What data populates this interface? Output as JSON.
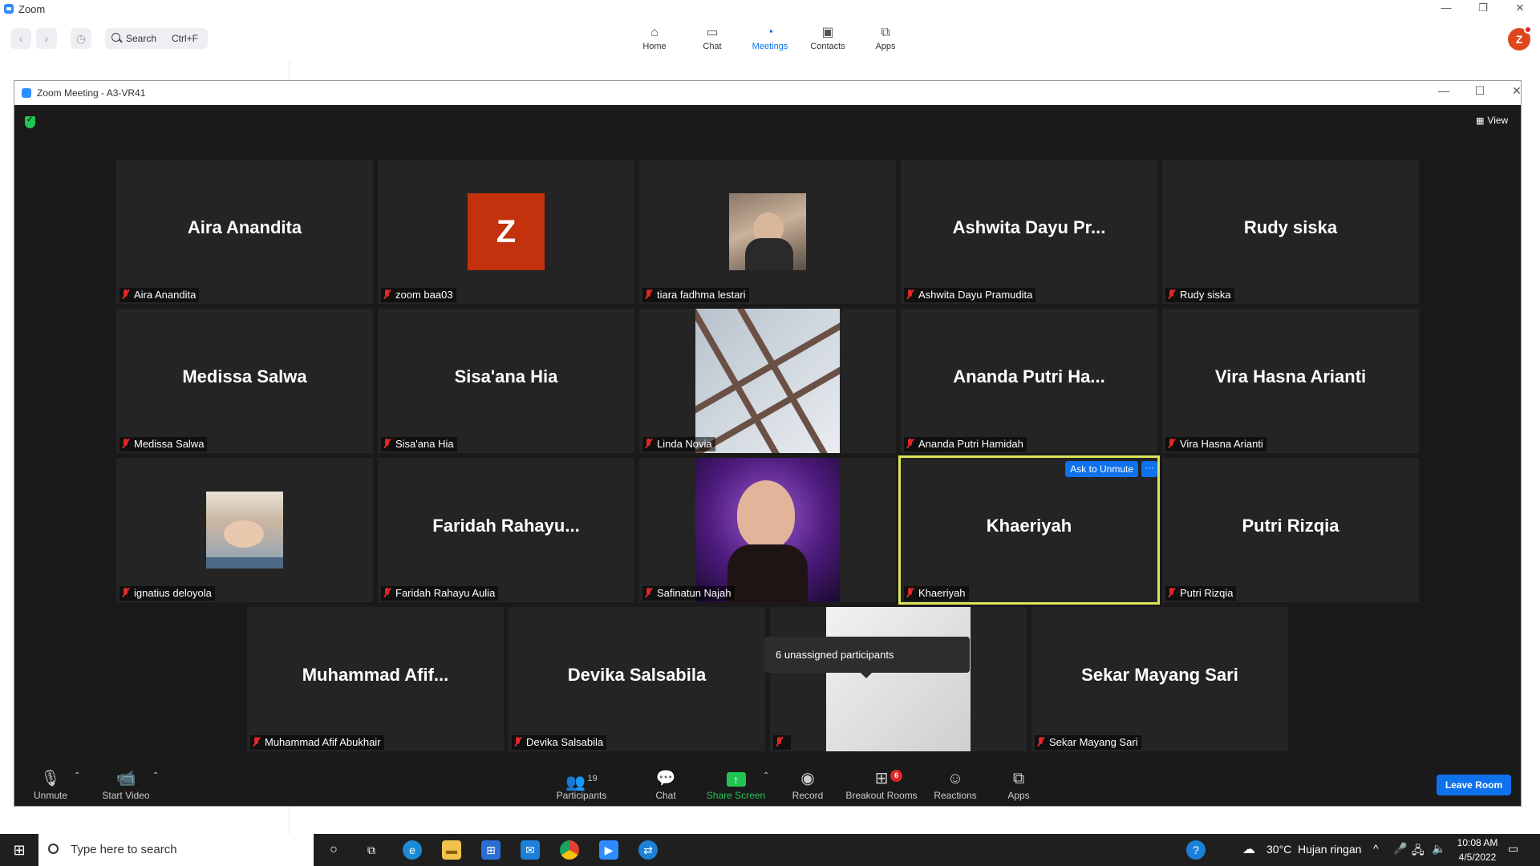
{
  "app": {
    "title": "Zoom"
  },
  "toolbar": {
    "search_label": "Search",
    "search_shortcut": "Ctrl+F",
    "nav": [
      {
        "label": "Home",
        "icon": "home-icon"
      },
      {
        "label": "Chat",
        "icon": "chat-icon"
      },
      {
        "label": "Meetings",
        "icon": "clock-icon",
        "active": true
      },
      {
        "label": "Contacts",
        "icon": "contacts-icon"
      },
      {
        "label": "Apps",
        "icon": "apps-icon"
      }
    ],
    "profile_initial": "Z"
  },
  "meeting": {
    "title": "Zoom Meeting - A3-VR41",
    "view_label": "View",
    "tiles": [
      {
        "name": "Aira Anandita",
        "display": "Aira Anandita"
      },
      {
        "name": "zoom baa03",
        "display": "",
        "avatar": "Z"
      },
      {
        "name": "tiara fadhma lestari",
        "display": ""
      },
      {
        "name": "Ashwita Dayu Pramudita",
        "display": "Ashwita Dayu Pr..."
      },
      {
        "name": "Rudy siska",
        "display": "Rudy siska"
      },
      {
        "name": "Medissa Salwa",
        "display": "Medissa Salwa"
      },
      {
        "name": "Sisa'ana Hia",
        "display": "Sisa'ana Hia"
      },
      {
        "name": "Linda Novia",
        "display": ""
      },
      {
        "name": "Ananda Putri Hamidah",
        "display": "Ananda Putri Ha..."
      },
      {
        "name": "Vira Hasna Arianti",
        "display": "Vira Hasna Arianti"
      },
      {
        "name": "ignatius deloyola",
        "display": ""
      },
      {
        "name": "Faridah Rahayu Aulia",
        "display": "Faridah  Rahayu..."
      },
      {
        "name": "Safinatun Najah",
        "display": ""
      },
      {
        "name": "Khaeriyah",
        "display": "Khaeriyah"
      },
      {
        "name": "Putri Rizqia",
        "display": "Putri Rizqia"
      },
      {
        "name": "Muhammad Afif Abukhair",
        "display": "Muhammad  Afif..."
      },
      {
        "name": "Devika Salsabila",
        "display": "Devika Salsabila"
      },
      {
        "name": "",
        "display": ""
      },
      {
        "name": "Sekar Mayang Sari",
        "display": "Sekar Mayang Sari"
      }
    ],
    "ask_to_unmute": "Ask to Unmute",
    "more": "···",
    "popup": "6 unassigned participants",
    "controls": {
      "unmute": "Unmute",
      "start_video": "Start Video",
      "participants": "Participants",
      "participants_count": "19",
      "chat": "Chat",
      "share_screen": "Share Screen",
      "record": "Record",
      "breakout_rooms": "Breakout Rooms",
      "breakout_badge": "6",
      "reactions": "Reactions",
      "apps": "Apps",
      "leave": "Leave Room"
    }
  },
  "taskbar": {
    "search_placeholder": "Type here to search",
    "weather_temp": "30°C",
    "weather_text": "Hujan ringan",
    "time": "10:08 AM",
    "date": "4/5/2022"
  },
  "colors": {
    "accent": "#0e72ed",
    "active_speaker": "#dde45a",
    "muted": "#e02828",
    "share": "#23c552"
  }
}
